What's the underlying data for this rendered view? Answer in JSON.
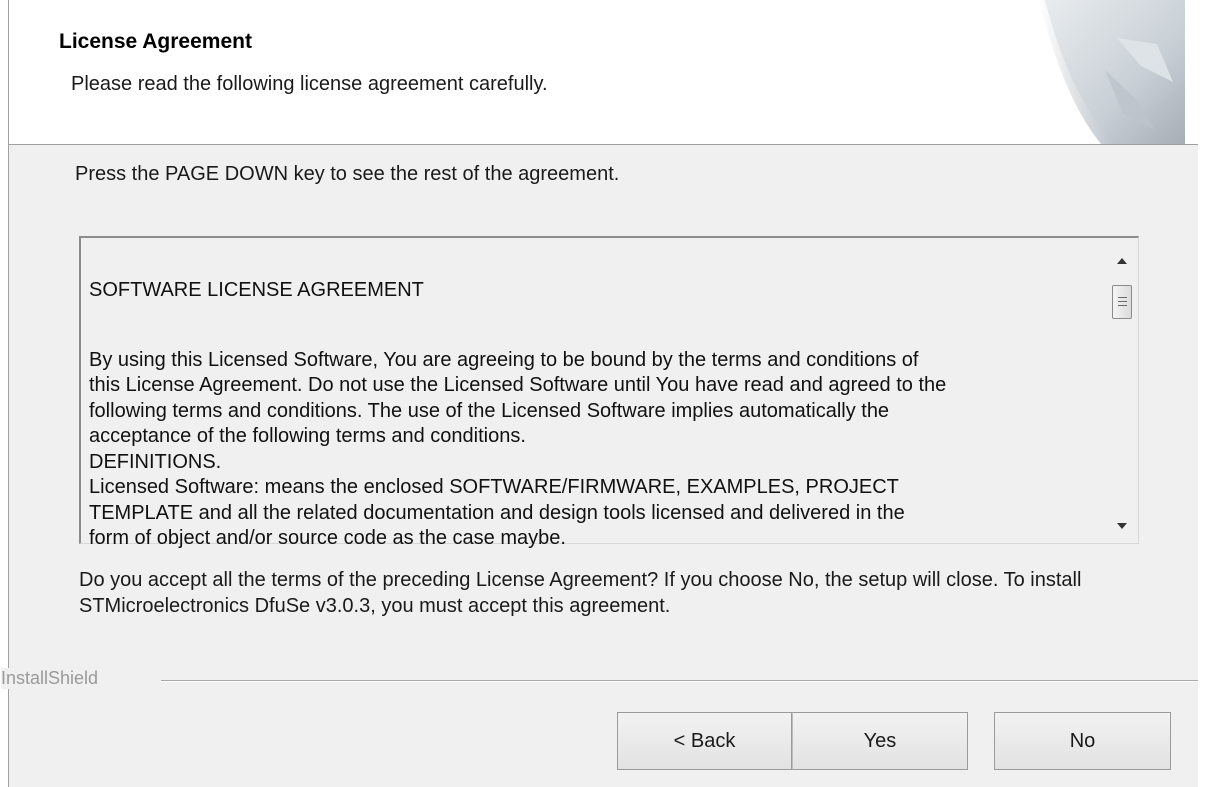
{
  "header": {
    "title": "License Agreement",
    "subtitle": "Please read the following license agreement carefully."
  },
  "instruction": "Press the PAGE DOWN key to see the rest of the agreement.",
  "license": {
    "heading": "SOFTWARE LICENSE AGREEMENT",
    "body": "By using this Licensed Software, You are agreeing to be bound by the terms and conditions of\nthis License Agreement. Do not use the Licensed Software until You have read and agreed to the\nfollowing terms and conditions. The use of the Licensed Software implies automatically the\nacceptance of the following terms and conditions.\nDEFINITIONS.\nLicensed Software: means the enclosed SOFTWARE/FIRMWARE, EXAMPLES, PROJECT\nTEMPLATE and all the related documentation and design tools licensed and delivered in the\nform of object and/or source code as the case maybe."
  },
  "question": "Do you accept all the terms of the preceding License Agreement?  If you choose No,  the setup will close.  To install STMicroelectronics DfuSe v3.0.3, you must accept this agreement.",
  "brand": "InstallShield",
  "buttons": {
    "back": "< Back",
    "yes": "Yes",
    "no": "No"
  },
  "icons": {
    "header_graphic": "installshield-page-curl-icon",
    "scroll_up": "scroll-up-arrow-icon",
    "scroll_down": "scroll-down-arrow-icon"
  }
}
